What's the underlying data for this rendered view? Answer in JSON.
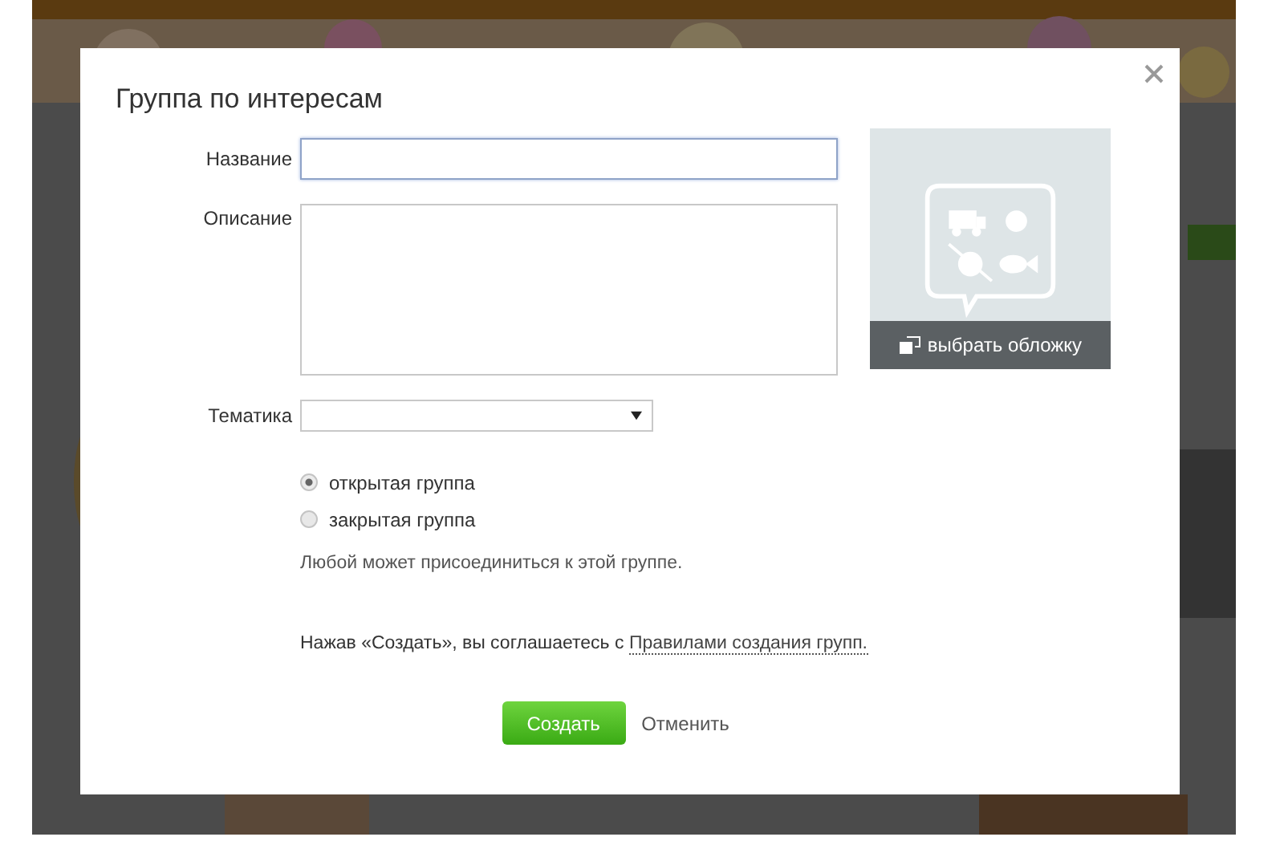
{
  "dialog": {
    "title": "Группа по интересам"
  },
  "fields": [
    {
      "label": "Название",
      "kind": "text",
      "focused": true
    },
    {
      "label": "Описание",
      "kind": "textarea",
      "focused": false
    },
    {
      "label": "Тематика",
      "kind": "select",
      "focused": false
    }
  ],
  "cover": {
    "button": "выбрать обложку"
  },
  "privacy": [
    {
      "label": "открытая группа",
      "selected": true
    },
    {
      "label": "закрытая группа",
      "selected": false
    }
  ],
  "privacy_hint": "Любой может присоединиться к этой группе.",
  "agreement": {
    "text": "Нажав «Создать», вы соглашаетесь с",
    "link": "Правилами создания групп."
  },
  "buttons": [
    {
      "label": "Создать",
      "kind": "primary"
    },
    {
      "label": "Отменить",
      "kind": "link"
    }
  ]
}
